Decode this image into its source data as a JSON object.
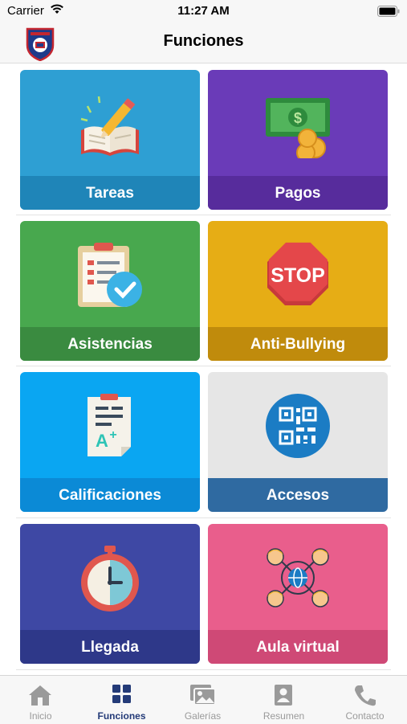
{
  "status": {
    "carrier": "Carrier",
    "time": "11:27 AM"
  },
  "nav": {
    "title": "Funciones",
    "logo_icon": "school-shield-logo"
  },
  "tiles": [
    {
      "label": "Tareas",
      "icon": "homework-book-pencil-icon",
      "color": "#2e9fd3",
      "band": "#1f85b8"
    },
    {
      "label": "Pagos",
      "icon": "money-coins-icon",
      "color": "#6a3bb8",
      "band": "#572c9c"
    },
    {
      "label": "Asistencias",
      "icon": "attendance-clipboard-check-icon",
      "color": "#48a84e",
      "band": "#3a8b40"
    },
    {
      "label": "Anti-Bullying",
      "icon": "stop-sign-icon",
      "color": "#e6ad15",
      "band": "#c08b0c"
    },
    {
      "label": "Calificaciones",
      "icon": "grades-document-icon",
      "color": "#0aa6f2",
      "band": "#0b8ad6"
    },
    {
      "label": "Accesos",
      "icon": "qr-code-icon",
      "color": "#e6e6e6",
      "band": "#2f6aa1"
    },
    {
      "label": "Llegada",
      "icon": "stopwatch-icon",
      "color": "#3e48a4",
      "band": "#2e3889"
    },
    {
      "label": "Aula virtual",
      "icon": "virtual-classroom-icon",
      "color": "#e95e8c",
      "band": "#cf4976"
    }
  ],
  "tabs": [
    {
      "label": "Inicio",
      "icon": "home-icon",
      "active": false
    },
    {
      "label": "Funciones",
      "icon": "grid-icon",
      "active": true
    },
    {
      "label": "Galerías",
      "icon": "gallery-icon",
      "active": false
    },
    {
      "label": "Resumen",
      "icon": "profile-card-icon",
      "active": false
    },
    {
      "label": "Contacto",
      "icon": "phone-icon",
      "active": false
    }
  ],
  "colors": {
    "active_tab": "#243b78",
    "inactive_tab": "#9a9a9a"
  }
}
